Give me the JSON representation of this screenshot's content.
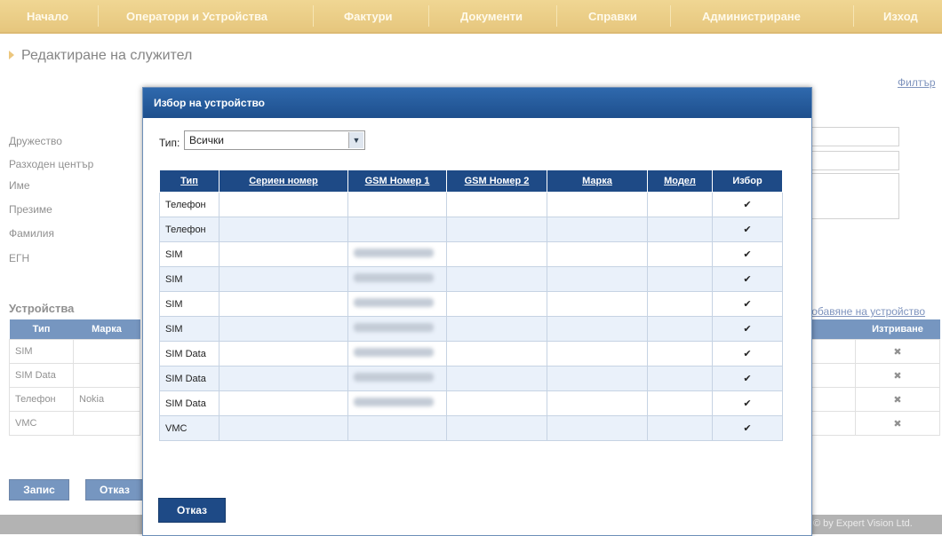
{
  "topnav": {
    "items": [
      "Начало",
      "Оператори и Устройства",
      "Фактури",
      "Документи",
      "Справки",
      "Администриране",
      "Изход"
    ]
  },
  "page": {
    "title": "Редактиране на служител",
    "filter_link": "Филтър"
  },
  "form": {
    "labels": [
      "Дружество",
      "Разходен център",
      "Име",
      "Презиме",
      "Фамилия",
      "ЕГН"
    ]
  },
  "devices_section": {
    "title": "Устройства",
    "add_link": "Добавяне на устройство",
    "headers": [
      "Тип",
      "Марка",
      "",
      "Изтриване"
    ],
    "rows": [
      {
        "type": "SIM",
        "brand": ""
      },
      {
        "type": "SIM Data",
        "brand": ""
      },
      {
        "type": "Телефон",
        "brand": "Nokia"
      },
      {
        "type": "VMC",
        "brand": ""
      }
    ]
  },
  "buttons": {
    "save": "Запис",
    "cancel": "Отказ"
  },
  "footer": {
    "text": "© by Expert Vision Ltd."
  },
  "modal": {
    "title": "Избор на устройство",
    "type_label": "Тип:",
    "type_selected": "Всички",
    "headers": [
      "Тип",
      "Сериен номер",
      "GSM Номер 1",
      "GSM Номер 2",
      "Марка",
      "Модел",
      "Избор"
    ],
    "rows": [
      {
        "type": "Телефон",
        "serial": "",
        "gsm1_masked": false,
        "gsm2": "",
        "brand": "",
        "model": ""
      },
      {
        "type": "Телефон",
        "serial": "",
        "gsm1_masked": false,
        "gsm2": "",
        "brand": "",
        "model": ""
      },
      {
        "type": "SIM",
        "serial": "",
        "gsm1_masked": true,
        "gsm2": "",
        "brand": "",
        "model": ""
      },
      {
        "type": "SIM",
        "serial": "",
        "gsm1_masked": true,
        "gsm2": "",
        "brand": "",
        "model": ""
      },
      {
        "type": "SIM",
        "serial": "",
        "gsm1_masked": true,
        "gsm2": "",
        "brand": "",
        "model": ""
      },
      {
        "type": "SIM",
        "serial": "",
        "gsm1_masked": true,
        "gsm2": "",
        "brand": "",
        "model": ""
      },
      {
        "type": "SIM Data",
        "serial": "",
        "gsm1_masked": true,
        "gsm2": "",
        "brand": "",
        "model": ""
      },
      {
        "type": "SIM Data",
        "serial": "",
        "gsm1_masked": true,
        "gsm2": "",
        "brand": "",
        "model": ""
      },
      {
        "type": "SIM Data",
        "serial": "",
        "gsm1_masked": true,
        "gsm2": "",
        "brand": "",
        "model": ""
      },
      {
        "type": "VMC",
        "serial": "",
        "gsm1_masked": false,
        "gsm2": "",
        "brand": "",
        "model": ""
      }
    ],
    "cancel_button": "Отказ"
  },
  "colors": {
    "nav_gold": "#d9a838",
    "header_blue": "#1e4a86",
    "row_alt": "#eaf1fa",
    "check_green": "#3a9a2a",
    "delete_red": "#c0202b"
  },
  "icons": {
    "select_check": "check-icon",
    "delete": "delete-x-icon",
    "dropdown": "chevron-down-icon",
    "title_arrow": "triangle-right-icon"
  }
}
